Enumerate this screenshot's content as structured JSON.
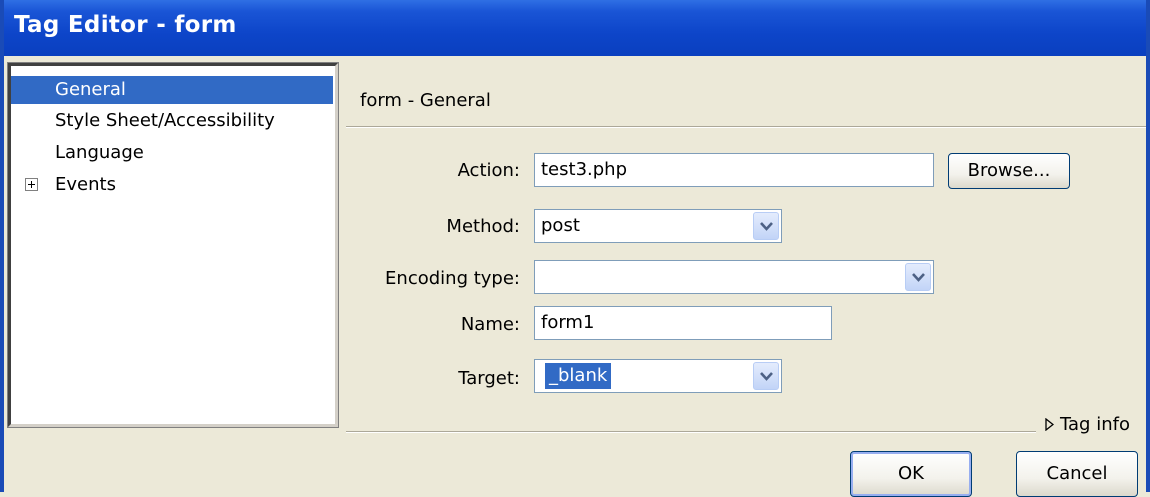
{
  "window": {
    "title": "Tag Editor - form"
  },
  "tree": {
    "items": [
      {
        "label": "General",
        "selected": true,
        "expandable": false
      },
      {
        "label": "Style Sheet/Accessibility",
        "selected": false,
        "expandable": false
      },
      {
        "label": "Language",
        "selected": false,
        "expandable": false
      },
      {
        "label": "Events",
        "selected": false,
        "expandable": true
      }
    ]
  },
  "panel": {
    "title": "form - General",
    "fields": {
      "action": {
        "label": "Action:",
        "value": "test3.php"
      },
      "method": {
        "label": "Method:",
        "value": "post"
      },
      "encoding": {
        "label": "Encoding type:",
        "value": ""
      },
      "name": {
        "label": "Name:",
        "value": "form1"
      },
      "target": {
        "label": "Target:",
        "value": "_blank"
      }
    },
    "browse_label": "Browse...",
    "tag_info_label": "Tag info"
  },
  "buttons": {
    "ok": "OK",
    "cancel": "Cancel"
  },
  "colors": {
    "titlebar": "#0a3fbf",
    "selection": "#316ac5",
    "background": "#ece9d8"
  }
}
